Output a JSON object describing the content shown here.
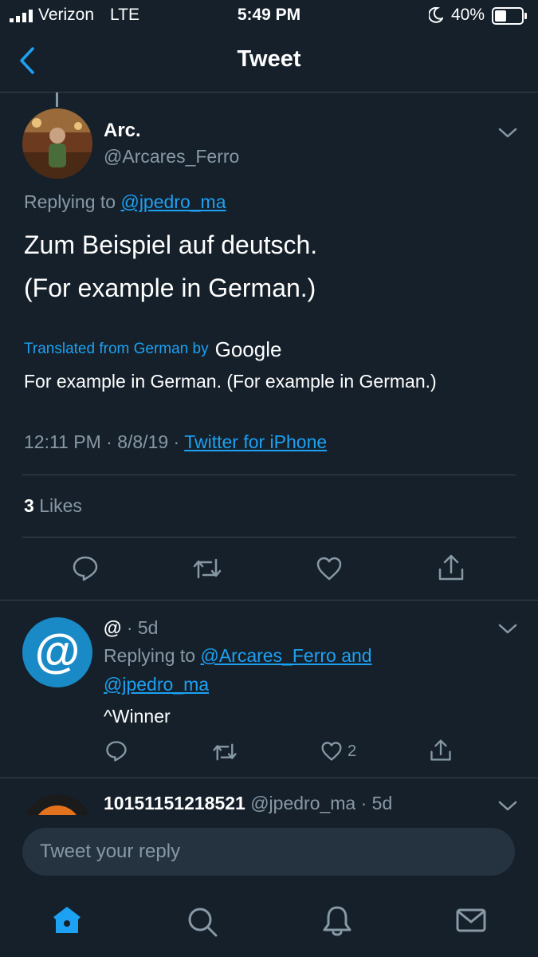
{
  "status_bar": {
    "carrier": "Verizon",
    "network": "LTE",
    "time": "5:49 PM",
    "battery": "40%"
  },
  "nav": {
    "title": "Tweet",
    "back_icon": "chevron-left-icon"
  },
  "main_tweet": {
    "name": "Arc.",
    "handle": "@Arcares_Ferro",
    "replying_prefix": "Replying to",
    "replying_to": "@jpedro_ma",
    "text_line1": "Zum Beispiel auf deutsch.",
    "text_line2": "(For example in German.)",
    "translated_label": "Translated from German by",
    "translator": "Google",
    "translation": "For example in German. (For example in German.)",
    "time": "12:11 PM",
    "date": "8/8/19",
    "separator": "·",
    "source": "Twitter for iPhone",
    "likes_count": "3",
    "likes_label": "Likes"
  },
  "replies": [
    {
      "avatar_glyph": "@",
      "name": "@",
      "age": "· 5d",
      "replying_prefix": "Replying to",
      "replying_to_line1": "@Arcares_Ferro and",
      "replying_to_line2": "@jpedro_ma",
      "text": "^Winner",
      "like_count": "2"
    },
    {
      "name": "10151151218521",
      "handle_age": "@jpedro_ma · 5d"
    }
  ],
  "composer": {
    "placeholder": "Tweet your reply"
  },
  "colors": {
    "background": "#15202b",
    "accent": "#1da1f2",
    "muted": "#8899a6",
    "divider": "#38444d"
  }
}
